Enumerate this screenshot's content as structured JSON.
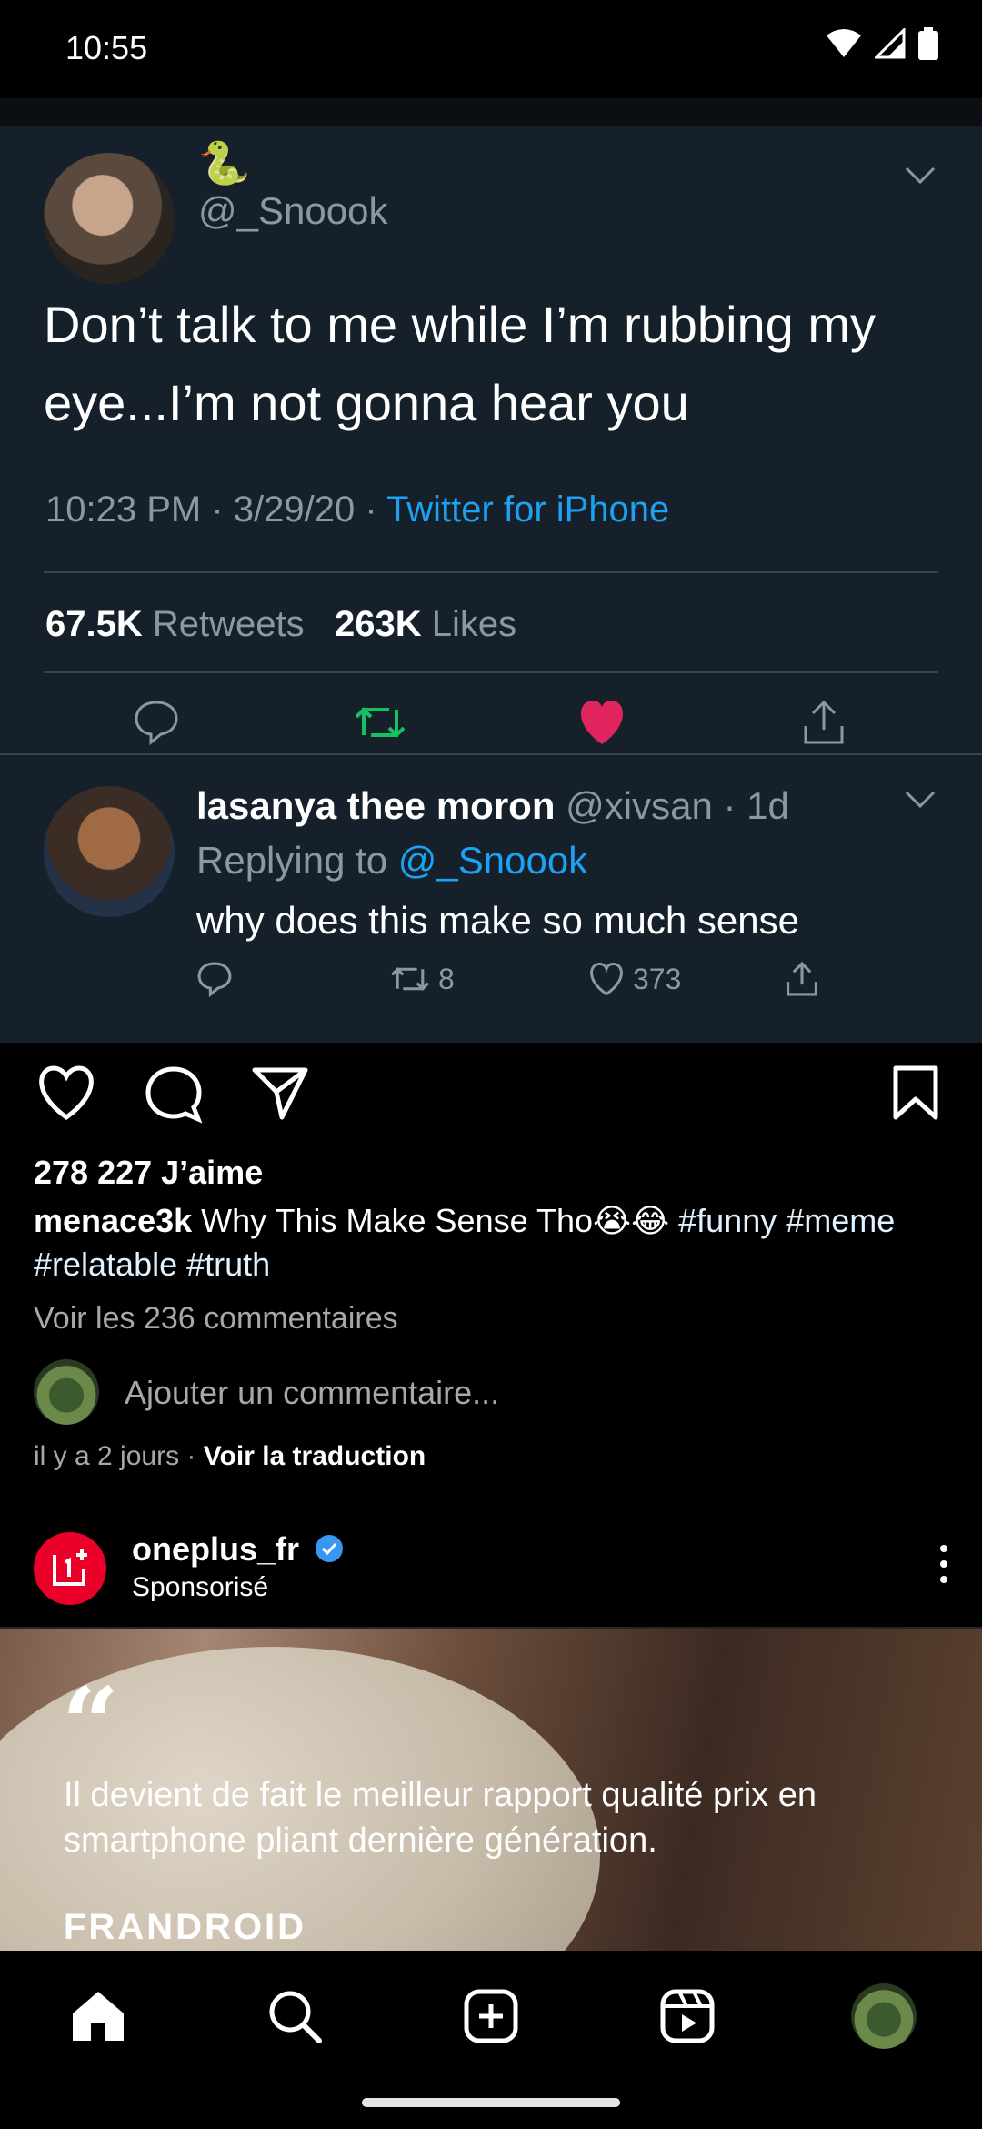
{
  "status_bar": {
    "time": "10:55"
  },
  "tweet": {
    "emoji": "🐍",
    "handle": "@_Snoook",
    "text": "Don’t talk to me while I’m rubbing my eye...I’m not gonna hear you",
    "time": "10:23 PM · 3/29/20 · ",
    "client": "Twitter for iPhone",
    "retweets_count": "67.5K",
    "retweets_label": " Retweets",
    "likes_count": "263K",
    "likes_label": " Likes",
    "colors": {
      "background": "#15202b",
      "retweet": "#17bf63",
      "like": "#e0245e",
      "link": "#1da1f2"
    }
  },
  "reply": {
    "name": "lasanya thee moron",
    "handle": " @xivsan · 1d",
    "replying_prefix": "Replying to ",
    "replying_to": "@_Snoook",
    "text": "why does this make so much sense",
    "retweets": "8",
    "likes": "373"
  },
  "post": {
    "likes": "278 227 J’aime",
    "author": "menace3k",
    "caption": " Why This Make Sense Tho😭😂 ",
    "tags": "#funny #meme #relatable #truth",
    "view_comments": "Voir les 236 commentaires",
    "comment_placeholder": "Ajouter un commentaire...",
    "time_ago": "il y a 2 jours",
    "separator": " · ",
    "translate": "Voir la traduction"
  },
  "sponsored": {
    "account": "oneplus_fr",
    "label": "Sponsorisé",
    "brand_color": "#eb0029",
    "ad_quote_mark": "“",
    "ad_quote": "Il devient de fait le meilleur rapport qualité prix en smartphone pliant dernière génération.",
    "ad_source": "FRANDROID"
  },
  "nav": {
    "items": [
      {
        "name": "home",
        "icon": "home-icon"
      },
      {
        "name": "search",
        "icon": "search-icon"
      },
      {
        "name": "create",
        "icon": "plus-square-icon"
      },
      {
        "name": "reels",
        "icon": "reels-icon"
      },
      {
        "name": "profile",
        "icon": "avatar"
      }
    ]
  }
}
